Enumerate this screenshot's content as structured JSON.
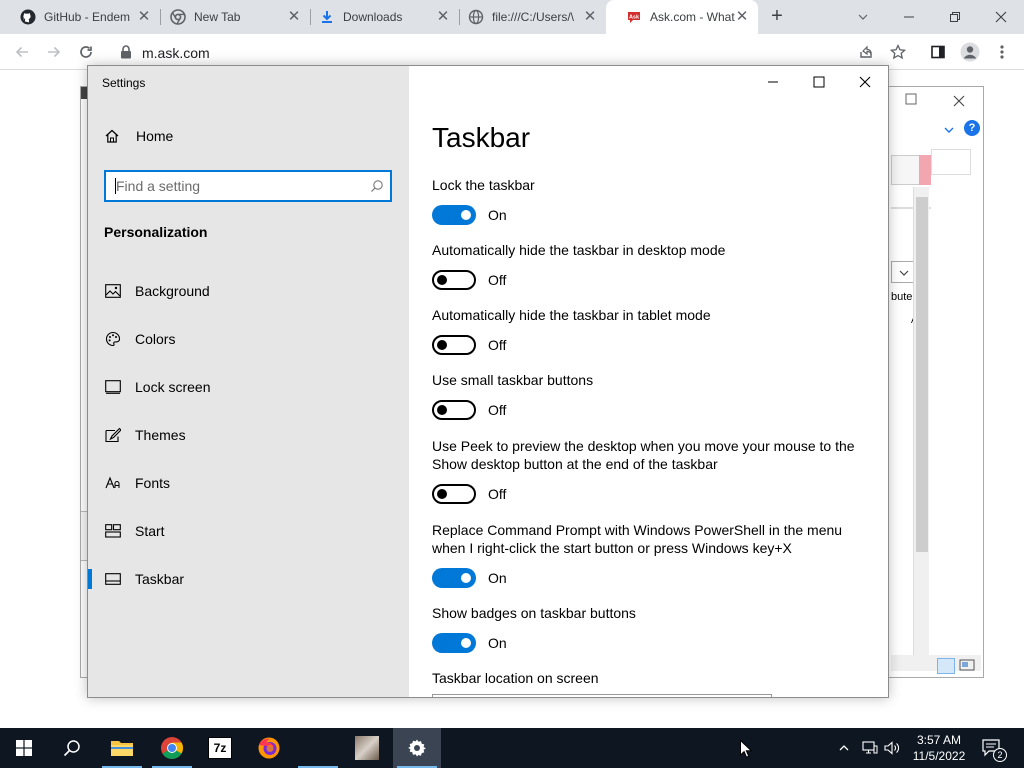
{
  "browser": {
    "tabs": [
      {
        "title": "GitHub - Endem",
        "icon": "github-icon"
      },
      {
        "title": "New Tab",
        "icon": "chrome-icon"
      },
      {
        "title": "Downloads",
        "icon": "download-icon"
      },
      {
        "title": "file:///C:/Users/\\",
        "icon": "globe-icon"
      },
      {
        "title": "Ask.com - What",
        "icon": "ask-icon",
        "active": true
      }
    ],
    "url": "m.ask.com"
  },
  "settings": {
    "app_title": "Settings",
    "home_label": "Home",
    "search_placeholder": "Find a setting",
    "section_header": "Personalization",
    "nav": [
      {
        "label": "Background",
        "icon": "picture-icon"
      },
      {
        "label": "Colors",
        "icon": "palette-icon"
      },
      {
        "label": "Lock screen",
        "icon": "lock-screen-icon"
      },
      {
        "label": "Themes",
        "icon": "themes-icon"
      },
      {
        "label": "Fonts",
        "icon": "fonts-icon"
      },
      {
        "label": "Start",
        "icon": "start-icon"
      },
      {
        "label": "Taskbar",
        "icon": "taskbar-icon",
        "selected": true
      }
    ],
    "page_title": "Taskbar",
    "options": [
      {
        "label": "Lock the taskbar",
        "state": "On"
      },
      {
        "label": "Automatically hide the taskbar in desktop mode",
        "state": "Off"
      },
      {
        "label": "Automatically hide the taskbar in tablet mode",
        "state": "Off"
      },
      {
        "label": "Use small taskbar buttons",
        "state": "Off"
      },
      {
        "label": "Use Peek to preview the desktop when you move your mouse to the Show desktop button at the end of the taskbar",
        "state": "Off"
      },
      {
        "label": "Replace Command Prompt with Windows PowerShell in the menu when I right-click the start button or press Windows key+X",
        "state": "On"
      },
      {
        "label": "Show badges on taskbar buttons",
        "state": "On"
      }
    ],
    "location_label": "Taskbar location on screen"
  },
  "background_window": {
    "partial_text": "bute",
    "partial_text_2": "A"
  },
  "taskbar": {
    "time": "3:57 AM",
    "date": "11/5/2022",
    "notification_count": "2"
  },
  "colors": {
    "accent": "#0078d7",
    "taskbar_bg": "#0e1621",
    "settings_nav_bg": "#e6e6e6"
  }
}
